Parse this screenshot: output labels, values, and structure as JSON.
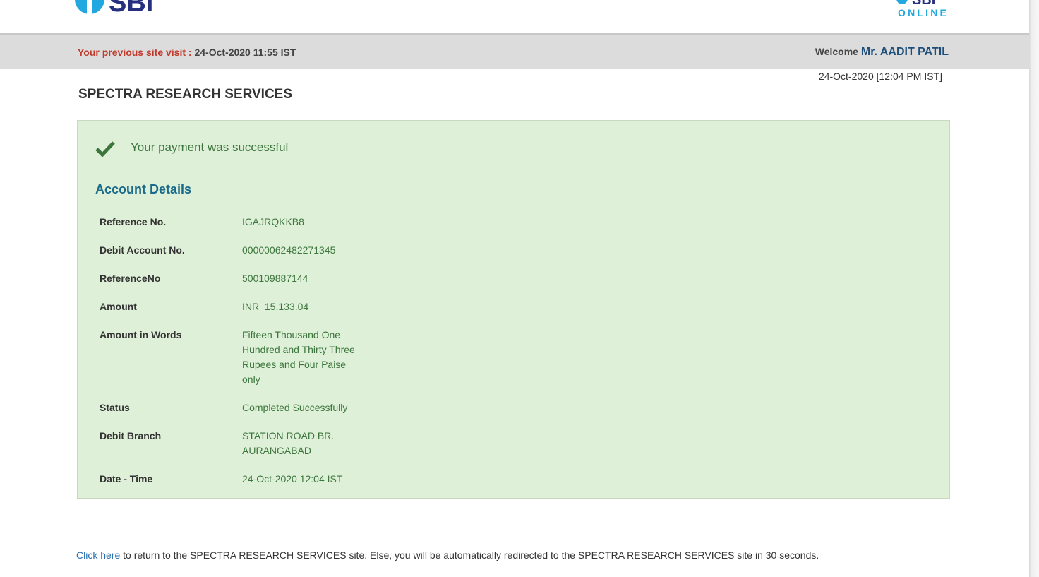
{
  "logos": {
    "left_wordmark": "SBI",
    "right_wordmark": "SBI",
    "right_sub": "ONLINE"
  },
  "info_bar": {
    "prev_visit_label": "Your previous site visit :",
    "prev_visit_value": "24-Oct-2020 11:55 IST",
    "welcome_label": "Welcome",
    "welcome_name": "Mr. AADIT PATIL"
  },
  "current_datetime": "24-Oct-2020 [12:04 PM IST]",
  "merchant_name": "SPECTRA RESEARCH SERVICES",
  "panel": {
    "success_message": "Your payment was successful",
    "section_title": "Account Details",
    "rows": [
      {
        "label": "Reference No.",
        "value": "IGAJRQKKB8"
      },
      {
        "label": "Debit Account No.",
        "value": "00000062482271345"
      },
      {
        "label": "ReferenceNo",
        "value": "500109887144"
      },
      {
        "label": "Amount",
        "value": "INR  15,133.04"
      },
      {
        "label": "Amount in Words",
        "value": "Fifteen Thousand One Hundred and Thirty Three Rupees and Four Paise only"
      },
      {
        "label": "Status",
        "value": "Completed Successfully"
      },
      {
        "label": "Debit Branch",
        "value": "STATION ROAD BR. AURANGABAD"
      },
      {
        "label": "Date - Time",
        "value": "24-Oct-2020 12:04 IST"
      }
    ]
  },
  "footer": {
    "link_text": "Click here",
    "rest_text": " to return to the SPECTRA RESEARCH SERVICES site. Else, you will be automatically redirected to the SPECTRA RESEARCH SERVICES site in 30 seconds."
  },
  "colors": {
    "panel_bg": "#dff0d8",
    "success_text": "#3c763d",
    "section_title": "#1a6a8a",
    "link": "#2a6fad",
    "prev_visit_label": "#c0392b"
  }
}
